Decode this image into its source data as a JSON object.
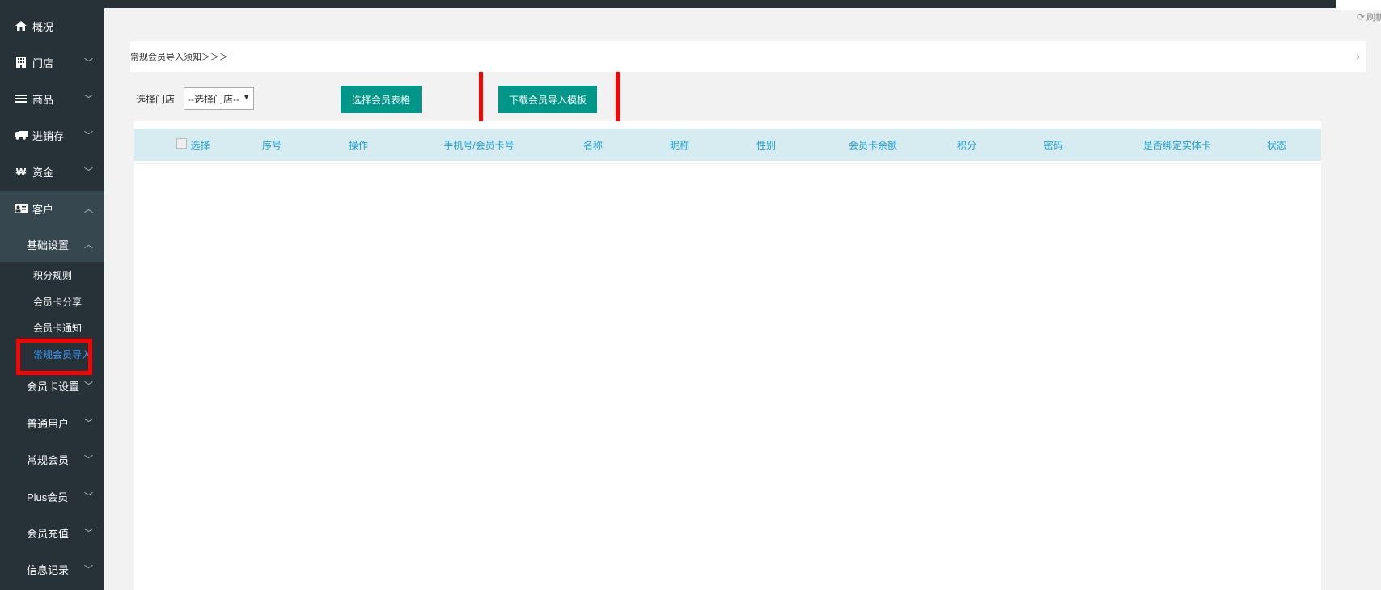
{
  "topbar": {
    "refresh_label": "刷新",
    "refresh_icon": "refresh-icon"
  },
  "sidebar": {
    "items": [
      {
        "label": "概况",
        "icon": "home-icon"
      },
      {
        "label": "门店",
        "icon": "building-icon"
      },
      {
        "label": "商品",
        "icon": "list-icon"
      },
      {
        "label": "进销存",
        "icon": "truck-icon"
      },
      {
        "label": "资金",
        "icon": "won-icon"
      },
      {
        "label": "客户",
        "icon": "id-card-icon"
      }
    ],
    "submenu_header": "基础设置",
    "submenu_items": [
      "积分规则",
      "会员卡分享",
      "会员卡通知",
      "常规会员导入"
    ],
    "groups": [
      "会员卡设置",
      "普通用户",
      "常规会员",
      "Plus会员",
      "会员充值",
      "信息记录"
    ]
  },
  "main": {
    "notice": "常规会员导入须知＞＞＞",
    "store_label": "选择门店",
    "store_select_value": "--选择门店--",
    "select_table_button": "选择会员表格",
    "download_template_button": "下载会员导入模板",
    "table_headers": [
      "选择",
      "序号",
      "操作",
      "手机号/会员卡号",
      "名称",
      "昵称",
      "性别",
      "会员卡余额",
      "积分",
      "密码",
      "是否绑定实体卡",
      "状态"
    ]
  },
  "colors": {
    "sidebar_bg": "#263238",
    "accent": "#009688",
    "link_active": "#3aa0ff",
    "header_text": "#19a0d6",
    "header_bg": "#d7ecf1",
    "highlight": "#ff0000"
  }
}
